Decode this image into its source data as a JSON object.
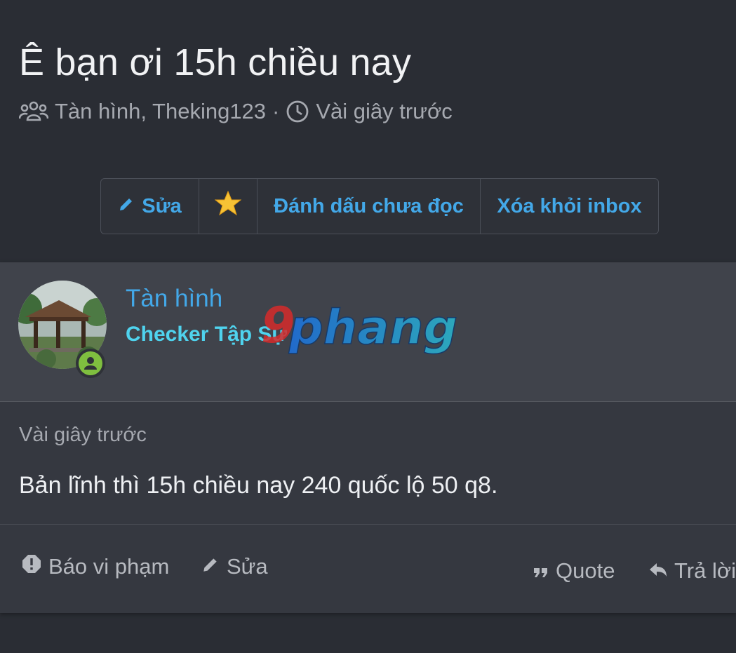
{
  "thread": {
    "title": "Ê bạn ơi 15h chiều nay",
    "participants": "Tàn hình, Theking123",
    "separator": "·",
    "time": "Vài giây trước"
  },
  "actions": {
    "edit_label": "Sửa",
    "star_icon": "star-icon",
    "mark_unread_label": "Đánh dấu chưa đọc",
    "remove_inbox_label": "Xóa khỏi inbox"
  },
  "message": {
    "author": "Tàn hình",
    "rank": "Checker Tập Sự",
    "watermark_text": "9phang",
    "time": "Vài giây trước",
    "body": "Bản lĩnh thì 15h chiều nay 240 quốc lộ 50 q8.",
    "footer": {
      "report_label": "Báo vi phạm",
      "edit_label": "Sửa",
      "quote_label": "Quote",
      "reply_label": "Trả lời"
    }
  },
  "colors": {
    "background": "#2a2d34",
    "accent": "#43a8e8",
    "rank": "#4fd3ee",
    "online": "#7fbf3f"
  }
}
